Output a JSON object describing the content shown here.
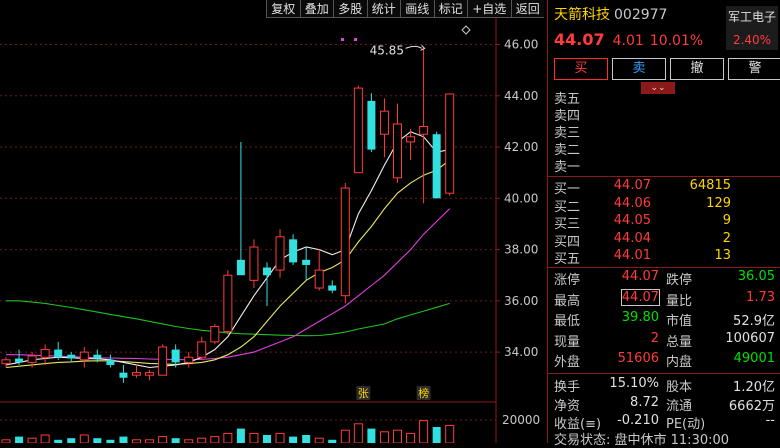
{
  "toolbar": [
    "复权",
    "叠加",
    "多股",
    "统计",
    "画线",
    "标记",
    "+自选",
    "返回"
  ],
  "stock": {
    "name": "天箭科技",
    "code": "002977",
    "price": "44.07",
    "change": "4.01",
    "change_pct": "10.01%",
    "sector_name": "军工电子",
    "sector_pct": "2.40%"
  },
  "actions": [
    "买",
    "卖",
    "撤",
    "警"
  ],
  "asks": [
    "卖五",
    "卖四",
    "卖三",
    "卖二",
    "卖一"
  ],
  "bids": [
    {
      "label": "买一",
      "price": "44.07",
      "vol": "64815"
    },
    {
      "label": "买二",
      "price": "44.06",
      "vol": "129"
    },
    {
      "label": "买三",
      "price": "44.05",
      "vol": "9"
    },
    {
      "label": "买四",
      "price": "44.04",
      "vol": "2"
    },
    {
      "label": "买五",
      "price": "44.01",
      "vol": "13"
    }
  ],
  "stats": [
    [
      {
        "k": "涨停",
        "v": "44.07",
        "c": "red"
      },
      {
        "k": "跌停",
        "v": "36.05",
        "c": "grn"
      }
    ],
    [
      {
        "k": "最高",
        "v": "44.07",
        "c": "red"
      },
      {
        "k": "量比",
        "v": "1.73",
        "c": "red"
      }
    ],
    [
      {
        "k": "最低",
        "v": "39.80",
        "c": "grn"
      },
      {
        "k": "市值",
        "v": "52.9亿",
        "c": "wht"
      }
    ],
    [
      {
        "k": "现量",
        "v": "2",
        "c": "red"
      },
      {
        "k": "总量",
        "v": "100607",
        "c": "wht"
      }
    ],
    [
      {
        "k": "外盘",
        "v": "51606",
        "c": "red"
      },
      {
        "k": "内盘",
        "v": "49001",
        "c": "grn"
      }
    ]
  ],
  "stats2": [
    [
      {
        "k": "换手",
        "v": "15.10%",
        "c": "wht"
      },
      {
        "k": "股本",
        "v": "1.20亿",
        "c": "wht"
      }
    ],
    [
      {
        "k": "净资",
        "v": "8.72",
        "c": "wht"
      },
      {
        "k": "流通",
        "v": "6662万",
        "c": "wht"
      }
    ],
    [
      {
        "k": "收益(≡)",
        "v": "-0.210",
        "c": "wht"
      },
      {
        "k": "PE(动)",
        "v": "--",
        "c": "wht"
      }
    ]
  ],
  "status": "交易状态: 盘中休市 11:30:00",
  "chart_data": {
    "type": "candlestick",
    "y_ticks": [
      "46.00",
      "44.00",
      "42.00",
      "40.00",
      "38.00",
      "36.00",
      "34.00"
    ],
    "vol_tick": "20000",
    "peak_label": "45.85",
    "markers": [
      "张",
      "榜"
    ],
    "ylim": [
      32.6,
      46.8
    ],
    "candles": [
      [
        33.55,
        33.8,
        33.4,
        33.7
      ],
      [
        33.75,
        34.1,
        33.5,
        33.6
      ],
      [
        33.6,
        34.0,
        33.4,
        33.85
      ],
      [
        33.8,
        34.3,
        33.5,
        34.1
      ],
      [
        34.1,
        34.4,
        33.7,
        33.8
      ],
      [
        33.9,
        34.0,
        33.6,
        33.75
      ],
      [
        33.7,
        34.2,
        33.4,
        34.0
      ],
      [
        33.9,
        34.1,
        33.6,
        33.75
      ],
      [
        33.7,
        33.9,
        33.4,
        33.5
      ],
      [
        33.2,
        33.5,
        32.8,
        33.0
      ],
      [
        33.1,
        33.5,
        33.0,
        33.2
      ],
      [
        33.1,
        33.3,
        32.9,
        33.2
      ],
      [
        33.1,
        34.3,
        33.1,
        34.2
      ],
      [
        34.1,
        34.3,
        33.4,
        33.6
      ],
      [
        33.6,
        34.0,
        33.4,
        33.8
      ],
      [
        33.8,
        34.6,
        33.7,
        34.4
      ],
      [
        34.4,
        35.1,
        34.3,
        35.0
      ],
      [
        34.8,
        37.2,
        34.7,
        37.0
      ],
      [
        37.6,
        42.2,
        37.4,
        37.0
      ],
      [
        36.8,
        38.4,
        36.5,
        38.1
      ],
      [
        37.3,
        37.5,
        35.8,
        37.0
      ],
      [
        37.2,
        38.8,
        36.9,
        38.5
      ],
      [
        38.4,
        38.6,
        37.4,
        37.5
      ],
      [
        37.6,
        38.1,
        36.8,
        37.4
      ],
      [
        36.5,
        38.0,
        36.4,
        37.2
      ],
      [
        36.6,
        36.8,
        36.3,
        36.4
      ],
      [
        36.2,
        40.6,
        35.9,
        40.4
      ],
      [
        41.0,
        44.4,
        41.0,
        44.3
      ],
      [
        43.8,
        44.1,
        41.8,
        41.9
      ],
      [
        42.5,
        43.9,
        41.6,
        43.4
      ],
      [
        40.8,
        43.7,
        40.6,
        42.9
      ],
      [
        42.2,
        42.7,
        41.5,
        42.4
      ],
      [
        42.5,
        45.85,
        39.8,
        42.8
      ],
      [
        42.5,
        42.6,
        40.0,
        40.0
      ],
      [
        40.2,
        44.1,
        40.1,
        44.07
      ]
    ],
    "ma5": [
      33.5,
      33.6,
      33.7,
      33.75,
      33.8,
      33.78,
      33.75,
      33.74,
      33.7,
      33.6,
      33.5,
      33.4,
      33.45,
      33.5,
      33.6,
      33.8,
      34.1,
      34.6,
      35.4,
      36.2,
      36.9,
      37.6,
      37.9,
      38.1,
      38.0,
      37.8,
      38.0,
      39.4,
      40.3,
      41.3,
      42.2,
      42.6,
      42.4,
      41.8,
      41.9
    ],
    "ma10": [
      33.4,
      33.45,
      33.5,
      33.55,
      33.6,
      33.62,
      33.65,
      33.66,
      33.66,
      33.63,
      33.6,
      33.56,
      33.54,
      33.52,
      33.55,
      33.6,
      33.7,
      33.9,
      34.2,
      34.6,
      35.2,
      35.8,
      36.3,
      36.8,
      37.1,
      37.3,
      37.6,
      38.3,
      38.9,
      39.6,
      40.2,
      40.6,
      40.9,
      41.1,
      41.5
    ],
    "ma20": [
      33.9,
      33.9,
      33.88,
      33.86,
      33.84,
      33.82,
      33.8,
      33.78,
      33.77,
      33.76,
      33.75,
      33.73,
      33.72,
      33.71,
      33.7,
      33.72,
      33.75,
      33.8,
      33.9,
      34.0,
      34.2,
      34.4,
      34.6,
      34.9,
      35.2,
      35.5,
      35.8,
      36.2,
      36.6,
      37.0,
      37.5,
      38.0,
      38.6,
      39.1,
      39.6
    ],
    "ma60": [
      36.0,
      36.0,
      35.95,
      35.9,
      35.82,
      35.74,
      35.65,
      35.56,
      35.47,
      35.38,
      35.3,
      35.2,
      35.1,
      35.0,
      34.92,
      34.85,
      34.8,
      34.75,
      34.72,
      34.7,
      34.68,
      34.66,
      34.65,
      34.64,
      34.65,
      34.7,
      34.78,
      34.9,
      35.0,
      35.1,
      35.3,
      35.45,
      35.6,
      35.75,
      35.9
    ],
    "volume_bars": [
      2,
      4,
      3,
      5,
      2,
      3,
      5,
      3,
      2,
      4,
      2,
      2,
      4,
      3,
      2,
      3,
      4,
      6,
      9,
      6,
      5,
      6,
      4,
      5,
      3,
      2,
      8,
      12,
      9,
      7,
      8,
      6,
      14,
      10,
      11
    ]
  }
}
